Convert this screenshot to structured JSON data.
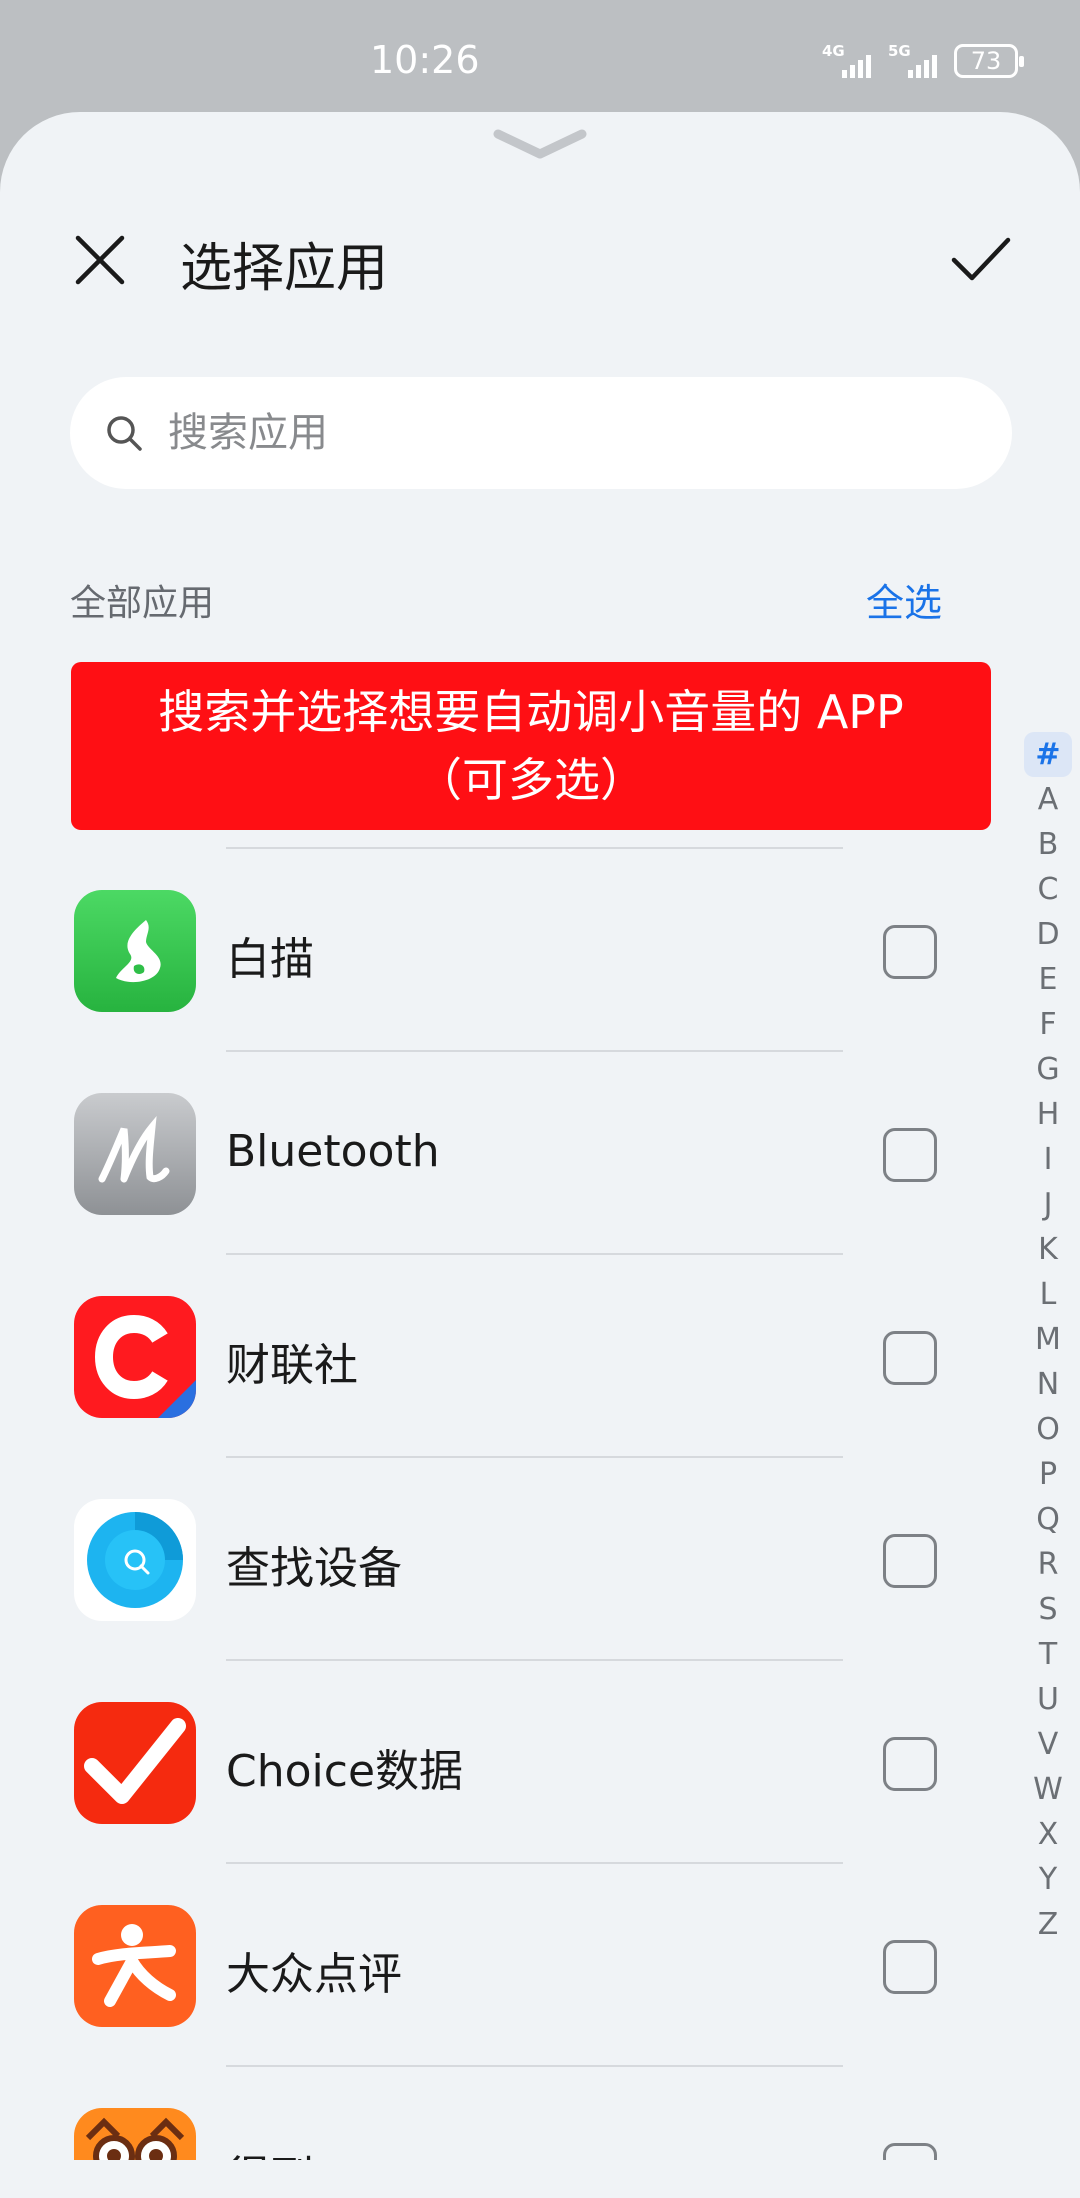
{
  "status_bar": {
    "time": "10:26",
    "network1": "4G",
    "network2": "5G",
    "battery": "73"
  },
  "header": {
    "title": "选择应用",
    "close_icon": "close-icon",
    "confirm_icon": "check-icon"
  },
  "search": {
    "placeholder": "搜索应用",
    "value": ""
  },
  "section": {
    "label": "全部应用",
    "select_all": "全选"
  },
  "banner": {
    "line1": "搜索并选择想要自动调小音量的 APP",
    "line2": "（可多选）"
  },
  "apps": [
    {
      "name": "白描",
      "checked": false,
      "icon": "baimiao-icon"
    },
    {
      "name": "Bluetooth",
      "checked": false,
      "icon": "bluetooth-app-icon"
    },
    {
      "name": "财联社",
      "checked": false,
      "icon": "cailianshe-icon"
    },
    {
      "name": "查找设备",
      "checked": false,
      "icon": "find-device-icon"
    },
    {
      "name": "Choice数据",
      "checked": false,
      "icon": "choice-icon"
    },
    {
      "name": "大众点评",
      "checked": false,
      "icon": "dianping-icon"
    },
    {
      "name": "得到",
      "checked": false,
      "icon": "dedao-icon"
    }
  ],
  "index_letters": [
    "#",
    "A",
    "B",
    "C",
    "D",
    "E",
    "F",
    "G",
    "H",
    "I",
    "J",
    "K",
    "L",
    "M",
    "N",
    "O",
    "P",
    "Q",
    "R",
    "S",
    "T",
    "U",
    "V",
    "W",
    "X",
    "Y",
    "Z"
  ],
  "colors": {
    "accent": "#1a73e8",
    "banner": "#ff0f14",
    "sheet_bg": "#f0f3f6"
  }
}
